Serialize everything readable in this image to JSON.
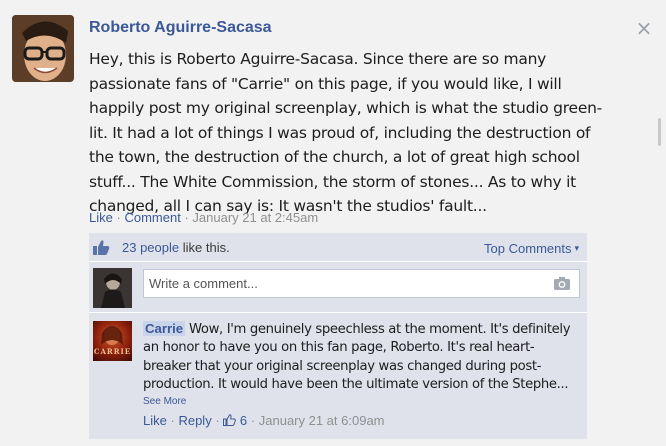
{
  "post": {
    "author": "Roberto Aguirre-Sacasa",
    "text": "Hey, this is Roberto Aguirre-Sacasa. Since there are so many\npassionate fans of \"Carrie\" on this page, if you would like, I will\nhappily post my original screenplay, which is what the studio green-\nlit. It had a lot of things I was proud of, including the destruction of\nthe town, the destruction of the church, a lot of great high school\nstuff... The White Commission, the storm of stones... As to why it\nchanged, all I can say is: It wasn't the studios' fault...",
    "like_label": "Like",
    "comment_label": "Comment",
    "separator": "·",
    "timestamp": "January 21 at 2:45am",
    "close_glyph": "×"
  },
  "likes": {
    "count_text": "23 people",
    "suffix": " like this.",
    "top_comments_label": "Top Comments",
    "caret": "▾"
  },
  "compose": {
    "placeholder": "Write a comment..."
  },
  "comment": {
    "author": "Carrie",
    "text": " Wow, I'm genuinely speechless at the moment. It's definitely an honor to have you on this fan page, Roberto. It's real heart-breaker that your original screenplay was changed during post-production. It would have been the ultimate version of the Stephe...",
    "see_more": "See More",
    "like_label": "Like",
    "reply_label": "Reply",
    "like_count": "6",
    "timestamp": "January 21 at 6:09am",
    "separator": "·",
    "avatar_word": "CARRIE"
  },
  "colors": {
    "link": "#3b5998",
    "background": "#f2f2f2",
    "feedback_panel": "#dfe2ea"
  },
  "icons": {
    "close": "close-icon",
    "thumbs_up": "thumbs-up-icon",
    "camera": "camera-icon"
  }
}
